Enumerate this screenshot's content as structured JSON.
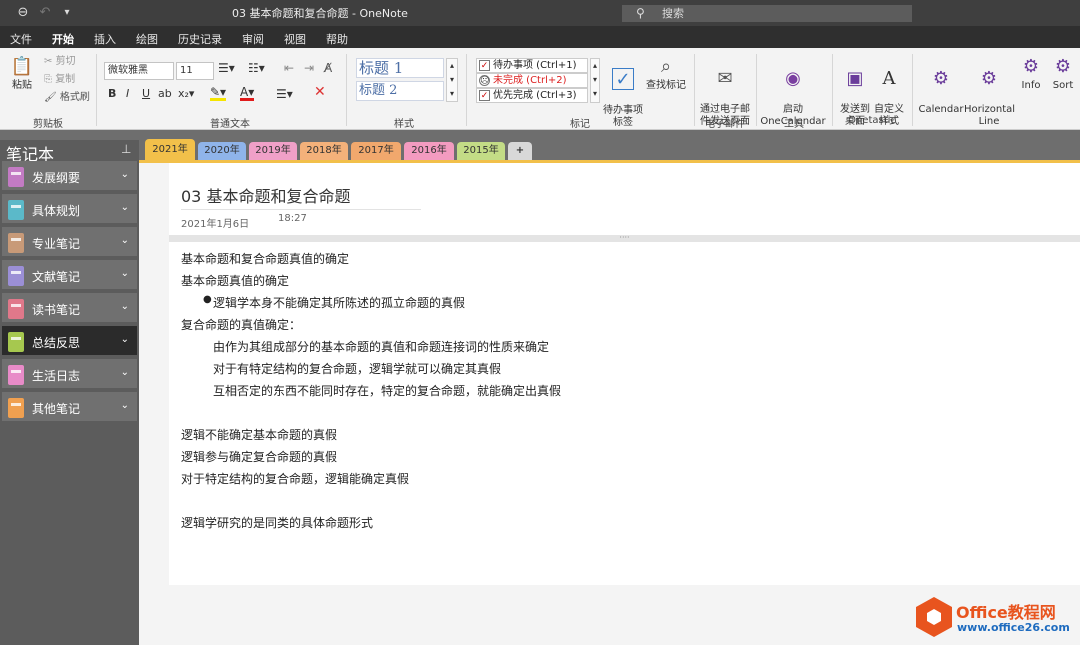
{
  "app": {
    "title": "03 基本命题和复合命题 - OneNote",
    "search_placeholder": "搜索"
  },
  "menu": [
    "文件",
    "开始",
    "插入",
    "绘图",
    "历史记录",
    "审阅",
    "视图",
    "帮助"
  ],
  "ribbon": {
    "clipboard": {
      "paste": "粘贴",
      "cut": "剪切",
      "copy": "复制",
      "format_painter": "格式刷",
      "label": "剪贴板"
    },
    "font": {
      "family": "微软雅黑",
      "size": "11",
      "label": "普通文本",
      "bold": "B",
      "italic": "I",
      "underline": "U"
    },
    "styles": {
      "heading1": "标题 1",
      "heading2": "标题 2",
      "label": "样式"
    },
    "tags": {
      "items": [
        "待办事项 (Ctrl+1)",
        "未完成 (Ctrl+2)",
        "优先完成 (Ctrl+3)"
      ],
      "todo_tag": "待办事项\n标签",
      "find_tags": "查找标记",
      "label": "标记"
    },
    "email": {
      "send": "通过电子邮\n件发送页面",
      "label": "电子邮件"
    },
    "tools": {
      "launch": "启动\nOneCalendar",
      "label": "工具"
    },
    "onetastic": {
      "send_to_desktop": "发送到\n桌面",
      "custom_style": "自定义\n样式",
      "label": "Onetastic"
    },
    "extra": [
      "Calendar",
      "Horizontal\nLine",
      "Info",
      "Sort"
    ]
  },
  "sidebar": {
    "header": "笔记本",
    "notebooks": [
      {
        "label": "发展纲要",
        "color": "#c37bc4"
      },
      {
        "label": "具体规划",
        "color": "#5bb9c9"
      },
      {
        "label": "专业笔记",
        "color": "#c89a78"
      },
      {
        "label": "文献笔记",
        "color": "#9b8fd6"
      },
      {
        "label": "读书笔记",
        "color": "#e0788a"
      },
      {
        "label": "总结反思",
        "color": "#a6c84f"
      },
      {
        "label": "生活日志",
        "color": "#e88bc8"
      },
      {
        "label": "其他笔记",
        "color": "#f0a050"
      }
    ]
  },
  "section_tabs": [
    {
      "label": "2021年",
      "color": "#f2c04a"
    },
    {
      "label": "2020年",
      "color": "#8fb4ea"
    },
    {
      "label": "2019年",
      "color": "#f0a0c8"
    },
    {
      "label": "2018年",
      "color": "#f4b17a"
    },
    {
      "label": "2017年",
      "color": "#f1a86d"
    },
    {
      "label": "2016年",
      "color": "#f39bc0"
    },
    {
      "label": "2015年",
      "color": "#c3dc86"
    },
    {
      "label": "+",
      "color": "#d8d8d8"
    }
  ],
  "page": {
    "title": "03 基本命题和复合命题",
    "date": "2021年1月6日",
    "time": "18:27",
    "lines": [
      "基本命题和复合命题真值的确定",
      "基本命题真值的确定",
      "逻辑学本身不能确定其所陈述的孤立命题的真假",
      "复合命题的真值确定：",
      "由作为其组成部分的基本命题的真值和命题连接词的性质来确定",
      "对于有特定结构的复合命题，逻辑学就可以确定其真假",
      "互相否定的东西不能同时存在，特定的复合命题，就能确定出真假",
      "逻辑不能确定基本命题的真假",
      "逻辑参与确定复合命题的真假",
      "对于特定结构的复合命题，逻辑能确定真假",
      "逻辑学研究的是同类的具体命题形式"
    ]
  },
  "watermark": {
    "brand": "Office教程网",
    "url": "www.office26.com"
  }
}
